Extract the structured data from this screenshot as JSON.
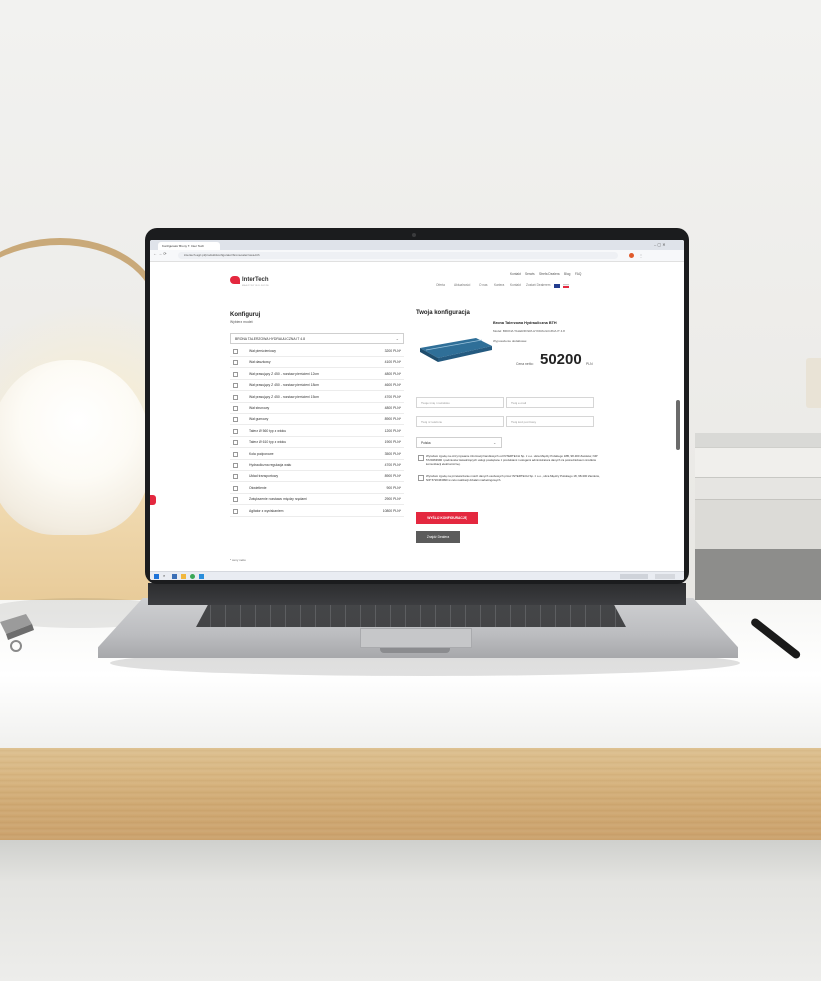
{
  "browser": {
    "tab_title": "Konfigurator Brony T. Inter Tech",
    "url": "intertech.agri.pl/produkt/konfigurator/brona-talerzowa-bth"
  },
  "site": {
    "logo_text": "InterTech",
    "logo_sub": "MASZYNY ROLNICZE",
    "top_links": [
      "Kontakt",
      "Serwis",
      "Strefa Dealera",
      "Blog",
      "FAQ"
    ],
    "nav": [
      "Oferta",
      "Aktualności",
      "O nas",
      "Kariera",
      "Kontakt",
      "Zostań Dealerem"
    ],
    "left_heading": "Konfiguruj",
    "model_label": "Wybierz model:",
    "model_value": "BRONA TALERZOWA HYDRAULICZNA IT 4.8",
    "options": [
      {
        "name": "Wał pierścieniowy",
        "price": "3200 PLN*"
      },
      {
        "name": "Wał daszkowy",
        "price": "4100 PLN*"
      },
      {
        "name": "Wał prasujący Z 450 - rozstaw pierścieni 12cm",
        "price": "4800 PLN*"
      },
      {
        "name": "Wał prasujący Z 450 - rozstaw pierścieni 18cm",
        "price": "4600 PLN*"
      },
      {
        "name": "Wał prasujący Z 450 - rozstaw pierścieni 15cm",
        "price": "4700 PLN*"
      },
      {
        "name": "Wał strunowy",
        "price": "4800 PLN*"
      },
      {
        "name": "Wał gumowy",
        "price": "8900 PLN*"
      },
      {
        "name": "Talerz Ø 560 typ z wtoku",
        "price": "1200 PLN*"
      },
      {
        "name": "Talerz Ø 610 typ z wtoku",
        "price": "1900 PLN*"
      },
      {
        "name": "Koła podporowe",
        "price": "3500 PLN*"
      },
      {
        "name": "Hydrauliczna regulacja wału",
        "price": "4700 PLN*"
      },
      {
        "name": "Układ transportowy",
        "price": "8900 PLN*"
      },
      {
        "name": "Oświetlenie",
        "price": "900 PLN*"
      },
      {
        "name": "Zwiększenie rozstawu między rzędami",
        "price": "2900 PLN*"
      },
      {
        "name": "Agitator z wyciskaniem",
        "price": "10800 PLN*"
      }
    ],
    "footnote": "* ceny netto",
    "right_heading": "Twoja konfiguracja",
    "product_name": "Brona Talerzowa Hydrauliczna BTH",
    "product_model": "Model: BRONA TALERZOWA HYDRAULICZNA IT 4.8",
    "equipment_label": "Wyposażenie dodatkowe:",
    "price_label": "Cena netto:",
    "price_value": "50200",
    "price_currency": "PLN",
    "fields": [
      {
        "placeholder": "Twoje imię i nazwisko"
      },
      {
        "placeholder": "Twój e-mail"
      },
      {
        "placeholder": "Twój nr telefonu"
      },
      {
        "placeholder": "Twój kod pocztowy"
      }
    ],
    "country_value": "Polska",
    "consent_1": "Wyrażam zgodę na otrzymywanie informacji handlowych od INTERTECH Sp. z o.o. ulica Między Polskiego 18B, 98-300 Zamków, NIP 5720463990 i podmiotów świadczących usługi powiązane z produktami i usługami administratora danych za pośrednictwem środków komunikacji elektronicznej.",
    "consent_2": "Wyrażam zgodę na przetwarzanie moich danych osobowych przez INTERTECH Sp. z o.o., ulica Między Polskiego 18, 98-300 Zamków, NIP 5720463990 w celu realizacji działań marketingowych.",
    "send_button": "WYŚLIJ KONFIGURACJĘ",
    "dealer_button": "Znajdź Dealera"
  },
  "colors": {
    "brand_red": "#e4283f",
    "dark_button": "#5b5b5b",
    "product_blue": "#2f6f98"
  }
}
